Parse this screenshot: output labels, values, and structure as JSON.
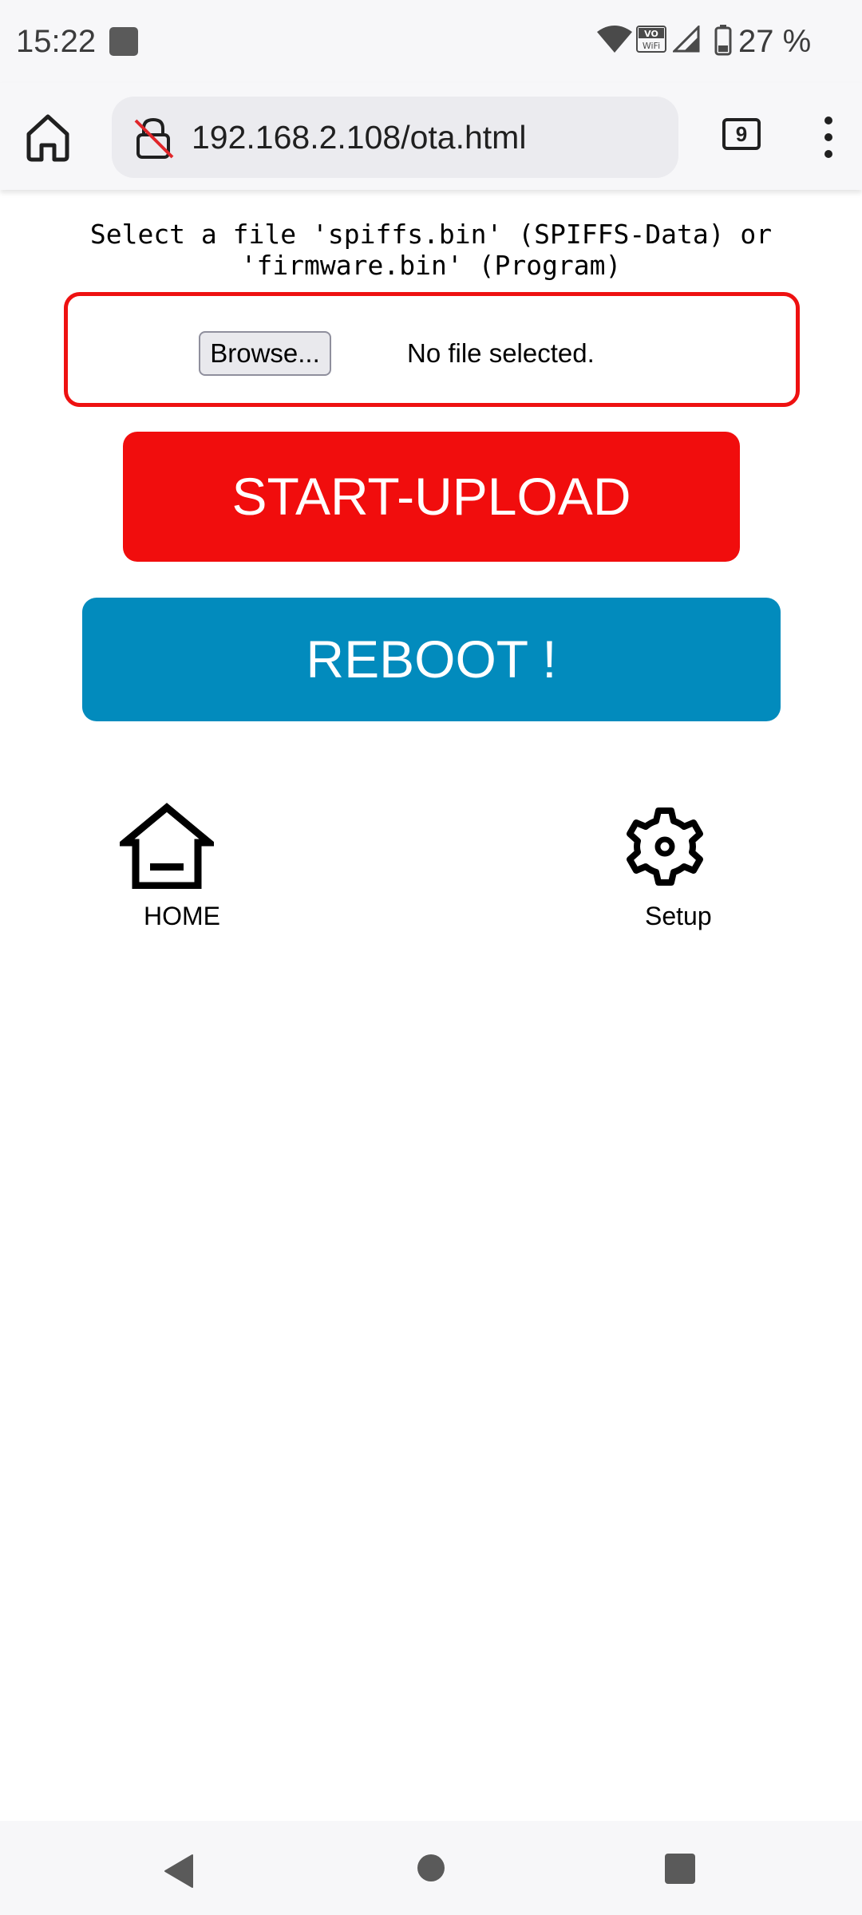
{
  "status_bar": {
    "time": "15:22",
    "battery_text": "27 %",
    "icons": [
      "app-notification-icon",
      "wifi-icon",
      "vowifi-icon",
      "cellular-signal-icon",
      "battery-icon"
    ]
  },
  "browser": {
    "url": "192.168.2.108/ota.html",
    "tab_count": "9",
    "icons": [
      "home-icon",
      "insecure-lock-icon",
      "tabs-icon",
      "overflow-menu-icon"
    ]
  },
  "page": {
    "instruction_line1": "Select a file 'spiffs.bin' (SPIFFS-Data) or",
    "instruction_line2": "'firmware.bin' (Program)",
    "file_input": {
      "button_label": "Browse...",
      "status": "No file selected."
    },
    "upload_button": "START-UPLOAD",
    "reboot_button": "REBOOT !",
    "nav": {
      "home_label": "HOME",
      "setup_label": "Setup"
    }
  },
  "colors": {
    "upload_button": "#f10d0d",
    "reboot_button": "#028bbd",
    "file_box_border": "#ee1111"
  }
}
